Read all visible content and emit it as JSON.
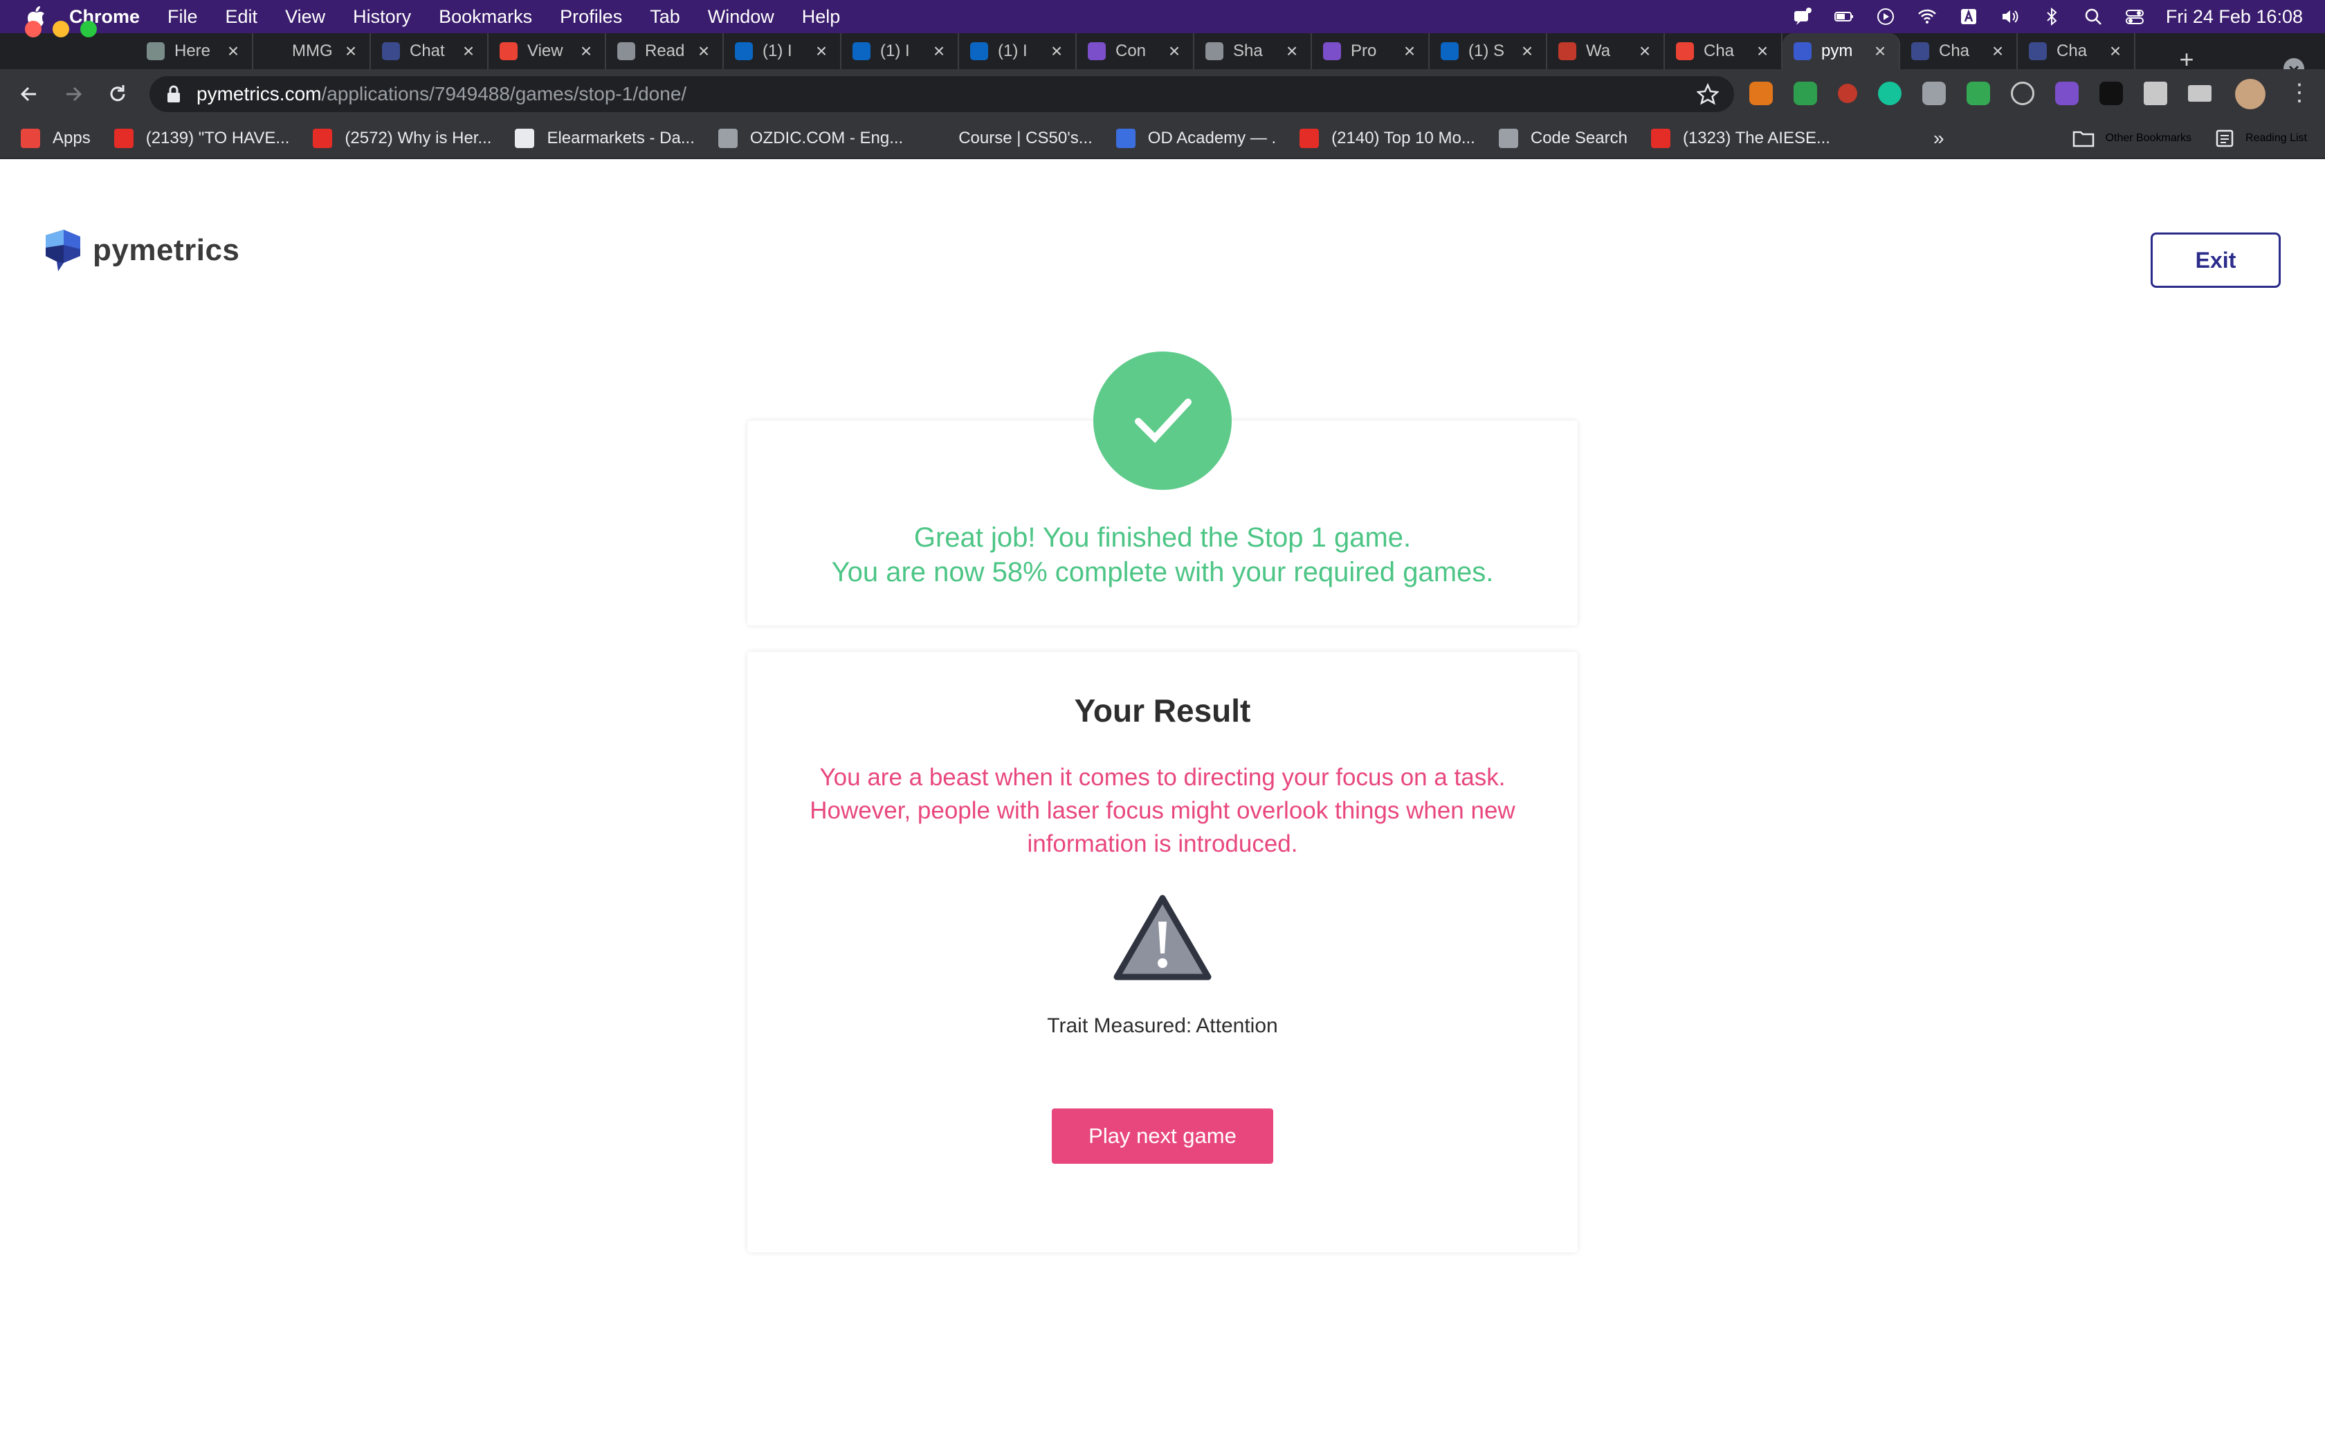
{
  "menubar": {
    "app_name": "Chrome",
    "items": [
      "File",
      "Edit",
      "View",
      "History",
      "Bookmarks",
      "Profiles",
      "Tab",
      "Window",
      "Help"
    ],
    "clock": "Fri 24 Feb  16:08"
  },
  "tabs": [
    {
      "title": "Here",
      "icon": "openai-icon",
      "color": "#7a8c87"
    },
    {
      "title": "MMG",
      "icon": "mmg-icon",
      "color": "#202124"
    },
    {
      "title": "Chat",
      "icon": "chat-icon",
      "color": "#3b4a8c"
    },
    {
      "title": "View",
      "icon": "gmail-icon",
      "color": "#ea4335"
    },
    {
      "title": "Read",
      "icon": "globe-icon",
      "color": "#8a8f96"
    },
    {
      "title": "(1) I",
      "icon": "linkedin-icon",
      "color": "#0a66c2"
    },
    {
      "title": "(1) I",
      "icon": "linkedin-icon",
      "color": "#0a66c2"
    },
    {
      "title": "(1) I",
      "icon": "linkedin-icon",
      "color": "#0a66c2"
    },
    {
      "title": "Con",
      "icon": "s-icon",
      "color": "#7b4fc9"
    },
    {
      "title": "Sha",
      "icon": "globe-icon",
      "color": "#8a8f96"
    },
    {
      "title": "Pro",
      "icon": "s-icon",
      "color": "#7b4fc9"
    },
    {
      "title": "(1) S",
      "icon": "linkedin-icon",
      "color": "#0a66c2"
    },
    {
      "title": "Wa",
      "icon": "wa-icon",
      "color": "#c0392b"
    },
    {
      "title": "Cha",
      "icon": "gmail-icon",
      "color": "#ea4335"
    },
    {
      "title": "pym",
      "icon": "pymetrics-icon",
      "color": "#3a5bd0",
      "active": true
    },
    {
      "title": "Cha",
      "icon": "chat-icon",
      "color": "#3b4a8c"
    },
    {
      "title": "Cha",
      "icon": "chat-icon",
      "color": "#3b4a8c"
    }
  ],
  "address": {
    "host": "pymetrics.com",
    "path": "/applications/7949488/games/stop-1/done/"
  },
  "bookmarks": [
    {
      "label": "Apps",
      "icon": "apps-grid-icon",
      "color": "#e8453c"
    },
    {
      "label": "(2139) \"TO HAVE...",
      "icon": "youtube-icon",
      "color": "#e52d27"
    },
    {
      "label": "(2572) Why is Her...",
      "icon": "youtube-icon",
      "color": "#e52d27"
    },
    {
      "label": "Elearmarkets - Da...",
      "icon": "chart-icon",
      "color": "#e8eaed"
    },
    {
      "label": "OZDIC.COM - Eng...",
      "icon": "oz-icon",
      "color": "#9aa0a6"
    },
    {
      "label": "Course | CS50's...",
      "icon": "edx-icon",
      "color": "#35363a"
    },
    {
      "label": "OD Academy — .",
      "icon": "od-icon",
      "color": "#3b6fe0"
    },
    {
      "label": "(2140) Top 10 Mo...",
      "icon": "youtube-icon",
      "color": "#e52d27"
    },
    {
      "label": "Code Search",
      "icon": "code-search-icon",
      "color": "#9aa0a6"
    },
    {
      "label": "(1323) The AIESE...",
      "icon": "youtube-icon",
      "color": "#e52d27"
    }
  ],
  "bookmarks_right": {
    "more": "»",
    "other": "Other Bookmarks",
    "reading": "Reading List"
  },
  "page": {
    "brand": "pymetrics",
    "exit_label": "Exit",
    "done_line1": "Great job! You finished the Stop 1 game.",
    "done_line2": "You are now 58% complete with your required games.",
    "result_title": "Your Result",
    "result_description": "You are a beast when it comes to directing your focus on a task. However, people with laser focus might overlook things when new information is introduced.",
    "trait_label": "Trait Measured:",
    "trait_value": "Attention",
    "play_next_label": "Play next game"
  },
  "colors": {
    "success_green": "#5ecb8a",
    "result_pink": "#e8477d",
    "exit_navy": "#2b2c8a"
  }
}
